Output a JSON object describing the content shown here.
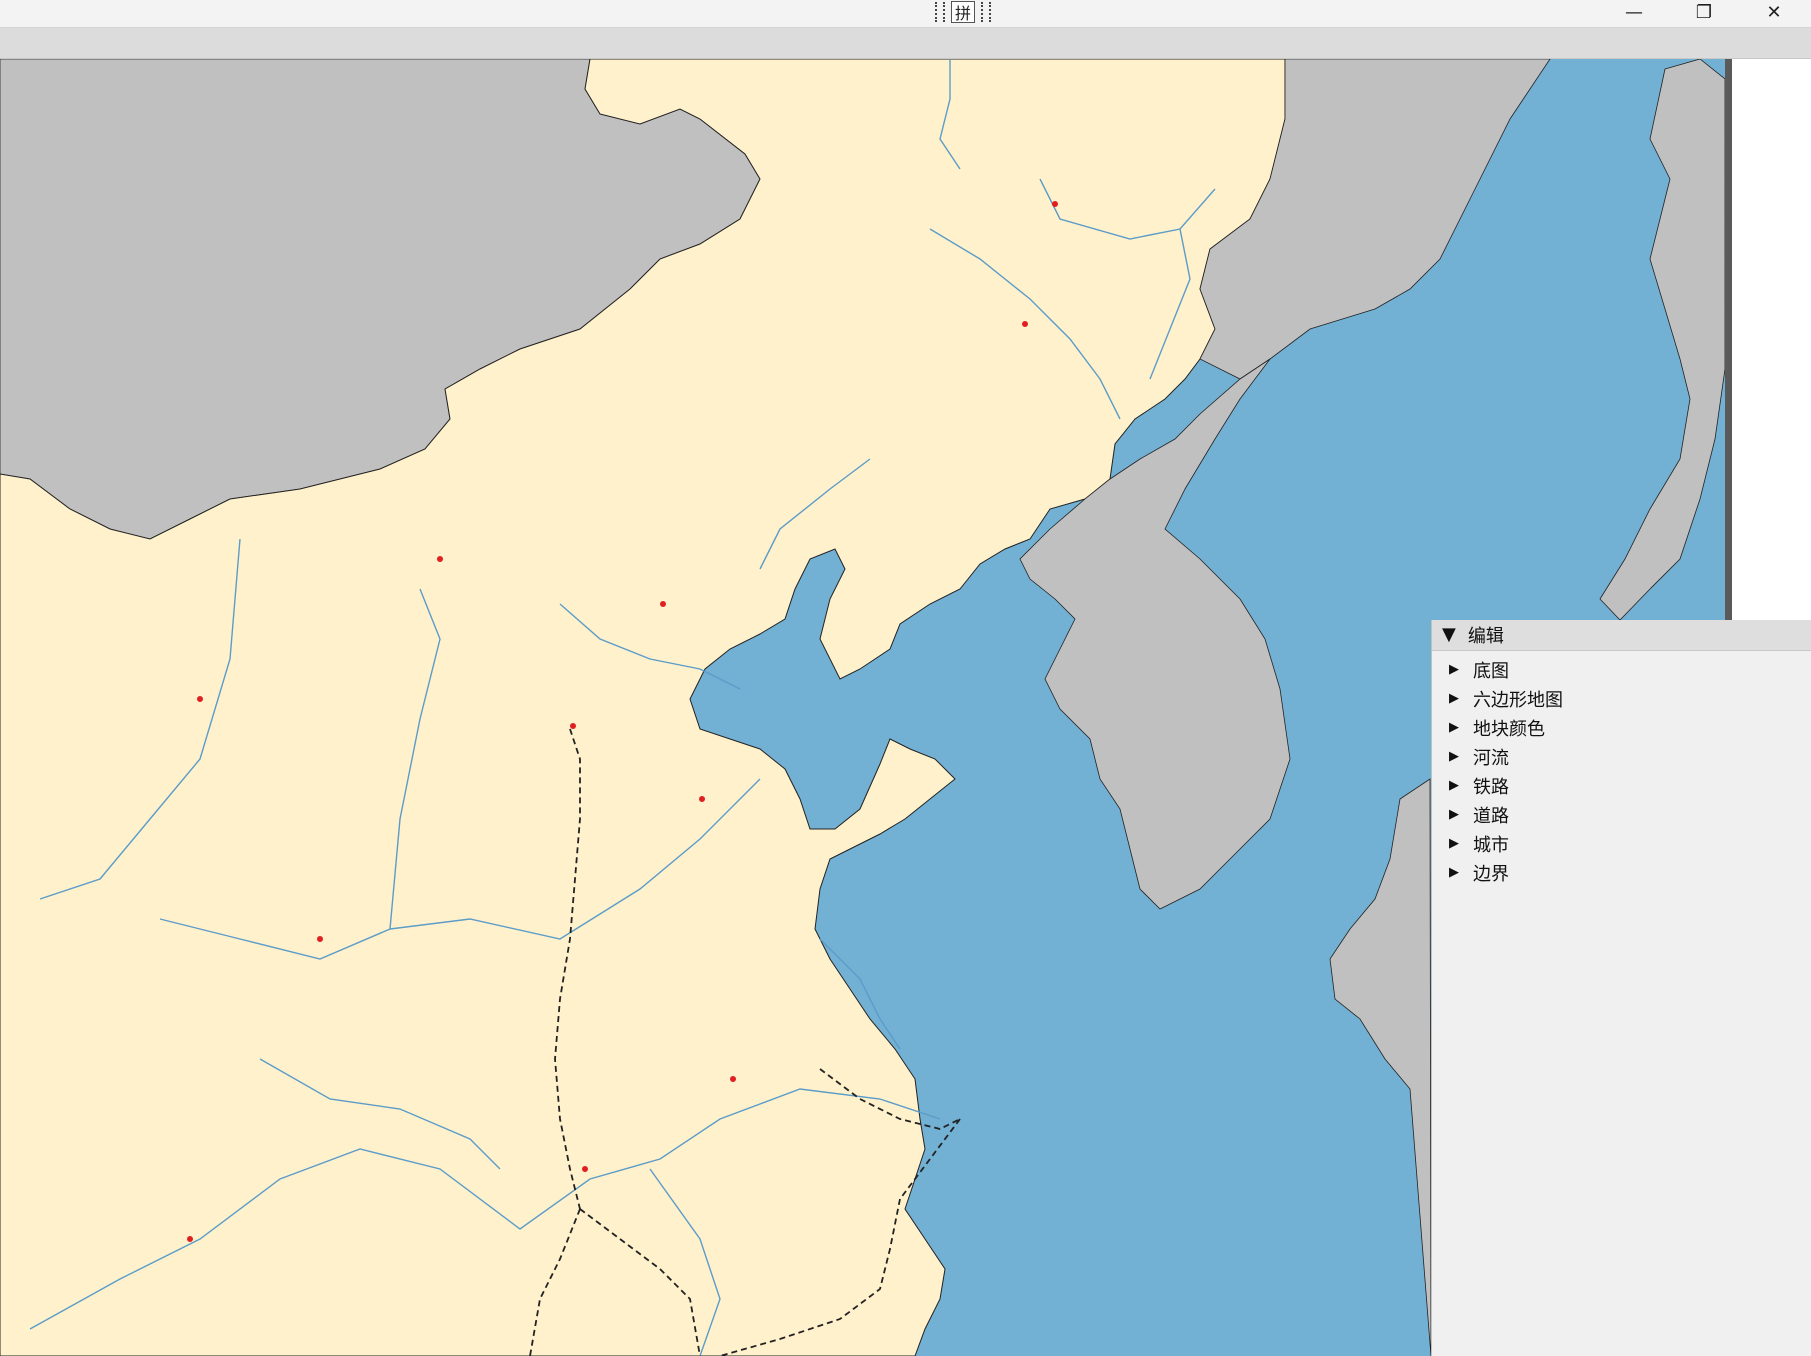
{
  "titlebar": {
    "ime_char": "拼",
    "minimize_glyph": "—",
    "restore_glyph": "❐",
    "close_glyph": "✕"
  },
  "colors": {
    "sea": "#72b0d4",
    "land_china": "#fff1cc",
    "land_foreign": "#c0c0c0",
    "river": "#5b9cc8",
    "border": "#222222",
    "railway": "#222222",
    "capital_marker": "#e02020"
  },
  "edit_panel": {
    "header_label": "编辑",
    "items": [
      {
        "label": "底图"
      },
      {
        "label": "六边形地图"
      },
      {
        "label": "地块颜色"
      },
      {
        "label": "河流"
      },
      {
        "label": "铁路"
      },
      {
        "label": "道路"
      },
      {
        "label": "城市"
      },
      {
        "label": "边界"
      }
    ]
  }
}
